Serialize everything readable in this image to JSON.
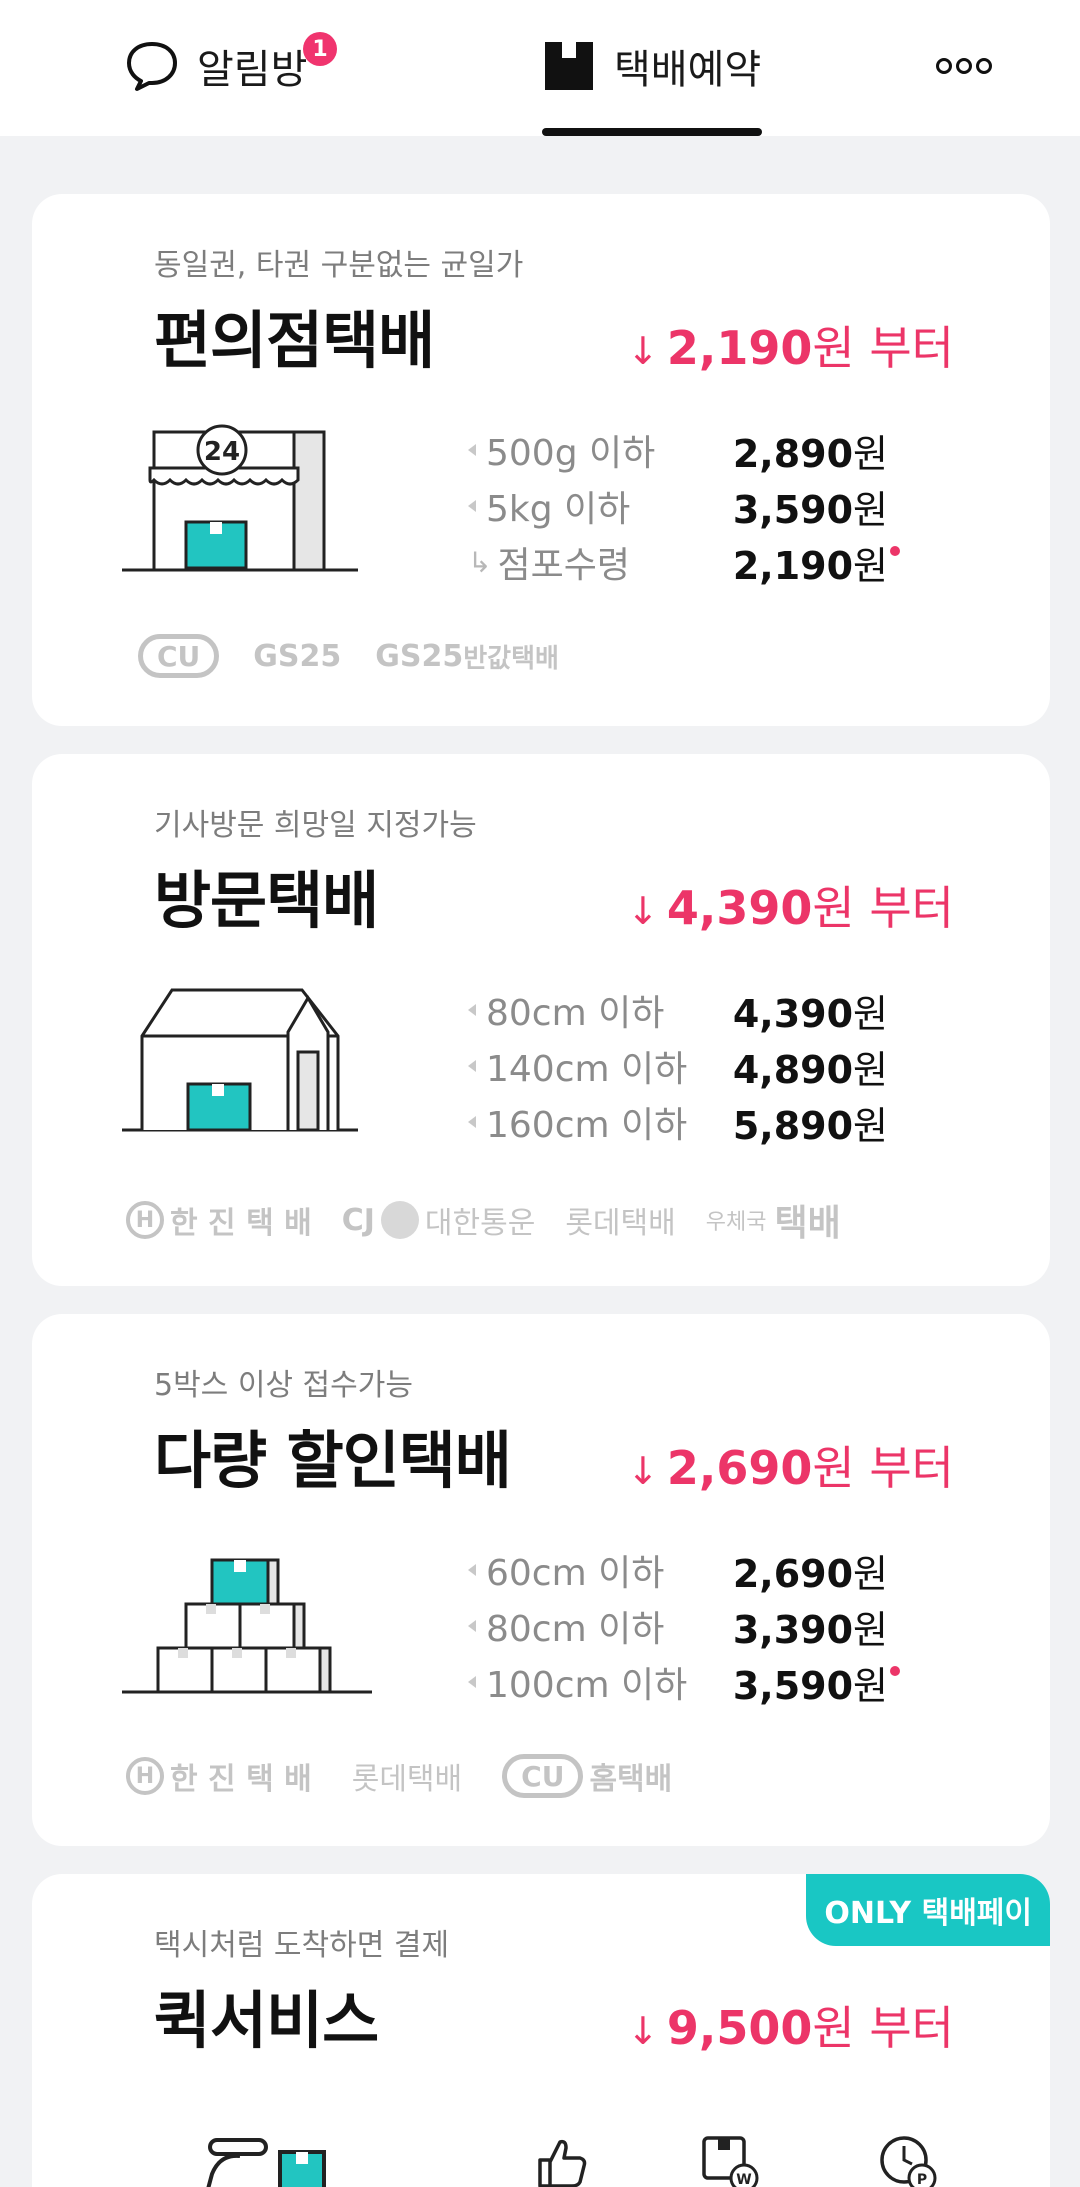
{
  "nav": {
    "alarm_label": "알림방",
    "alarm_badge": "1",
    "delivery_label": "택배예약"
  },
  "colors": {
    "accent": "#ec3568",
    "teal": "#19c7c4",
    "badge": "#f0346e"
  },
  "cards": [
    {
      "subtitle": "동일권, 타권 구분없는 균일가",
      "title": "편의점택배",
      "price_from": {
        "arrow": "↓",
        "amount": "2,190",
        "unit": "원 부터"
      },
      "rates": [
        {
          "label": "500g 이하",
          "amount": "2,890",
          "unit": "원"
        },
        {
          "label": "5kg 이하",
          "amount": "3,590",
          "unit": "원"
        },
        {
          "label": "점포수령",
          "amount": "2,190",
          "unit": "원",
          "prefix": "↳"
        }
      ],
      "carriers": [
        "CU",
        "GS25",
        "GS25",
        "반값택배"
      ]
    },
    {
      "subtitle": "기사방문 희망일 지정가능",
      "title": "방문택배",
      "price_from": {
        "arrow": "↓",
        "amount": "4,390",
        "unit": "원 부터"
      },
      "rates": [
        {
          "label": "80cm 이하",
          "amount": "4,390",
          "unit": "원"
        },
        {
          "label": "140cm 이하",
          "amount": "4,890",
          "unit": "원"
        },
        {
          "label": "160cm 이하",
          "amount": "5,890",
          "unit": "원"
        }
      ],
      "carriers": [
        "H",
        "한 진 택 배",
        "CJ",
        "대한통운",
        "롯데택배",
        "우체국",
        "택배"
      ]
    },
    {
      "subtitle": "5박스 이상 접수가능",
      "title": "다량 할인택배",
      "price_from": {
        "arrow": "↓",
        "amount": "2,690",
        "unit": "원 부터"
      },
      "rates": [
        {
          "label": "60cm 이하",
          "amount": "2,690",
          "unit": "원"
        },
        {
          "label": "80cm 이하",
          "amount": "3,390",
          "unit": "원"
        },
        {
          "label": "100cm 이하",
          "amount": "3,590",
          "unit": "원"
        }
      ],
      "carriers": [
        "H",
        "한 진 택 배",
        "롯데택배",
        "CU",
        "홈택배"
      ]
    },
    {
      "badge": "ONLY 택배페이",
      "subtitle": "택시처럼 도착하면 결제",
      "title": "퀵서비스",
      "price_from": {
        "arrow": "↓",
        "amount": "9,500",
        "unit": "원 부터"
      },
      "icons": [
        "scooter-icon",
        "thumbs-up-icon",
        "box-won-icon",
        "clock-p-icon"
      ],
      "icon_letters": [
        "W",
        "P"
      ]
    }
  ]
}
